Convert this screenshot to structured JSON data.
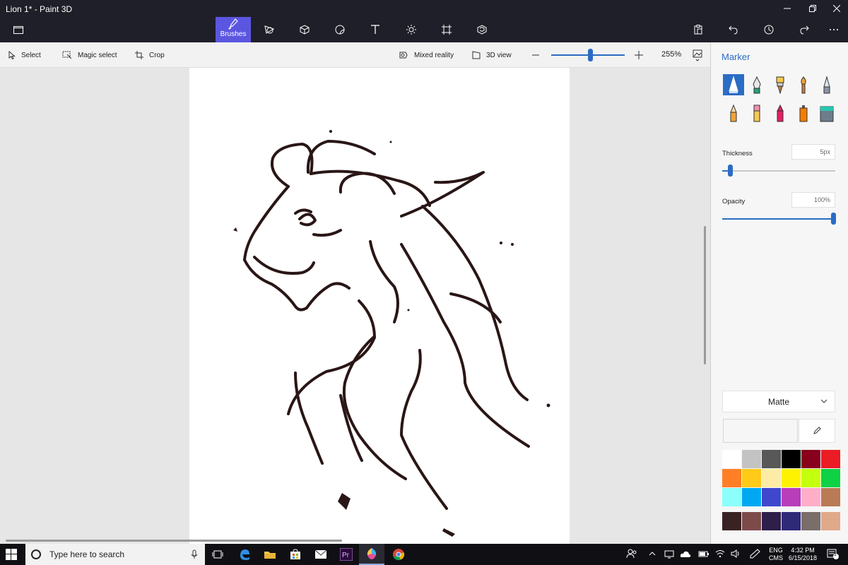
{
  "window": {
    "title": "Lion 1* - Paint 3D"
  },
  "toolbar": {
    "brushes_label": "Brushes",
    "select_label": "Select",
    "magic_select_label": "Magic select",
    "crop_label": "Crop",
    "mixed_reality_label": "Mixed reality",
    "view3d_label": "3D view",
    "zoom_value": "255%",
    "zoom_level_fraction": 0.53
  },
  "panel": {
    "title": "Marker",
    "thickness_label": "Thickness",
    "thickness_value": "5px",
    "thickness_fraction": 0.05,
    "opacity_label": "Opacity",
    "opacity_value": "100%",
    "opacity_fraction": 1.0,
    "finish": "Matte",
    "brushes": [
      "marker",
      "calligraphy-pen",
      "oil-brush",
      "watercolor",
      "pixel-pen",
      "pencil",
      "eraser",
      "crayon",
      "spray-can",
      "fill"
    ],
    "active_brush": "marker",
    "palette": [
      "#ffffff",
      "#c3c3c3",
      "#585858",
      "#000000",
      "#88001b",
      "#ec1c24",
      "#ff7f27",
      "#ffca18",
      "#fdeca6",
      "#fff200",
      "#c4ff0e",
      "#0ed145",
      "#8cfffb",
      "#00a8f3",
      "#3f48cc",
      "#b83dba",
      "#ffaec8",
      "#b97a56"
    ],
    "custom_colors": [
      "#3b2222",
      "#7d4a4a",
      "#2d1e4a",
      "#2e2a78",
      "#7a6e6a",
      "#e0a98a"
    ]
  },
  "taskbar": {
    "search_placeholder": "Type here to search",
    "language_top": "ENG",
    "language_bottom": "CMS",
    "time": "4:32 PM",
    "date": "6/15/2018",
    "notification_count": "1"
  }
}
